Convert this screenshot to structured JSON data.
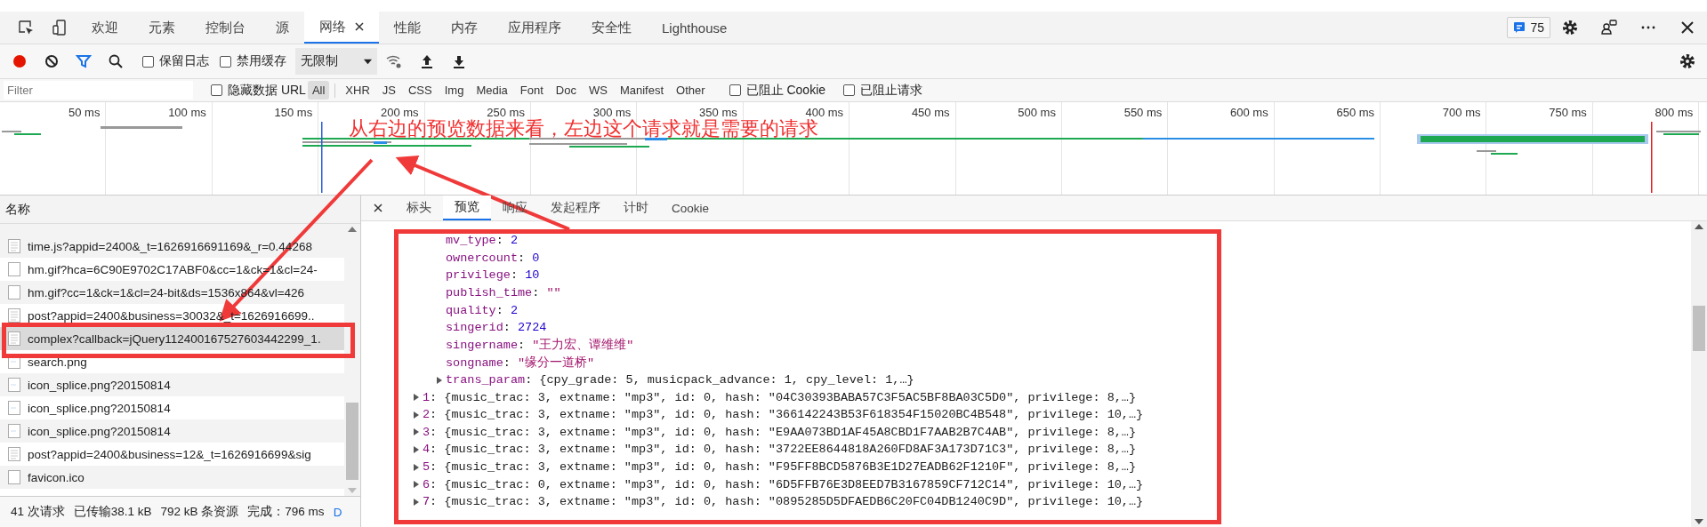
{
  "devtools_tabs": [
    {
      "label": "欢迎",
      "selected": false,
      "closable": false
    },
    {
      "label": "元素",
      "selected": false,
      "closable": false
    },
    {
      "label": "控制台",
      "selected": false,
      "closable": false
    },
    {
      "label": "源",
      "selected": false,
      "closable": false
    },
    {
      "label": "网络",
      "selected": true,
      "closable": true
    },
    {
      "label": "性能",
      "selected": false,
      "closable": false
    },
    {
      "label": "内存",
      "selected": false,
      "closable": false
    },
    {
      "label": "应用程序",
      "selected": false,
      "closable": false
    },
    {
      "label": "安全性",
      "selected": false,
      "closable": false
    },
    {
      "label": "Lighthouse",
      "selected": false,
      "closable": false
    }
  ],
  "issues_badge": "75",
  "toolbar": {
    "recording": true,
    "preserve_log": {
      "label": "保留日志",
      "checked": false
    },
    "disable_cache": {
      "label": "禁用缓存",
      "checked": false
    },
    "throttling": "无限制"
  },
  "filter_bar": {
    "placeholder": "Filter",
    "hide_data_urls": {
      "label": "隐藏数据 URL",
      "checked": false
    },
    "types": [
      {
        "label": "All",
        "selected": true
      },
      {
        "label": "XHR",
        "selected": false
      },
      {
        "label": "JS",
        "selected": false
      },
      {
        "label": "CSS",
        "selected": false
      },
      {
        "label": "Img",
        "selected": false
      },
      {
        "label": "Media",
        "selected": false
      },
      {
        "label": "Font",
        "selected": false
      },
      {
        "label": "Doc",
        "selected": false
      },
      {
        "label": "WS",
        "selected": false
      },
      {
        "label": "Manifest",
        "selected": false
      },
      {
        "label": "Other",
        "selected": false
      }
    ],
    "blocked_cookies": {
      "label": "已阻止 Cookie",
      "checked": false
    },
    "blocked_requests": {
      "label": "已阻止请求",
      "checked": false
    }
  },
  "overview": {
    "ticks": [
      "50 ms",
      "100 ms",
      "150 ms",
      "200 ms",
      "250 ms",
      "300 ms",
      "350 ms",
      "400 ms",
      "450 ms",
      "500 ms",
      "550 ms",
      "600 ms",
      "650 ms",
      "700 ms",
      "750 ms",
      "800 ms"
    ]
  },
  "annotation": {
    "text": "从右边的预览数据来看，左边这个请求就是需要的请求"
  },
  "requests": {
    "column": "名称",
    "rows": [
      {
        "name": "time.js?appid=2400&_t=1626916691169&_r=0.44268",
        "kind": "document",
        "selected": false
      },
      {
        "name": "hm.gif?hca=6C90E9702C17ABF0&cc=1&ck=1&cl=24-",
        "kind": "blank",
        "selected": false
      },
      {
        "name": "hm.gif?cc=1&ck=1&cl=24-bit&ds=1536x864&vl=426",
        "kind": "blank",
        "selected": false
      },
      {
        "name": "post?appid=2400&business=30032&_t=1626916699..",
        "kind": "document",
        "selected": false
      },
      {
        "name": "complex?callback=jQuery112400167527603442299_1.",
        "kind": "document",
        "selected": true
      },
      {
        "name": "search.png",
        "kind": "image",
        "selected": false
      },
      {
        "name": "icon_splice.png?20150814",
        "kind": "image",
        "selected": false
      },
      {
        "name": "icon_splice.png?20150814",
        "kind": "image",
        "selected": false
      },
      {
        "name": "icon_splice.png?20150814",
        "kind": "image",
        "selected": false
      },
      {
        "name": "post?appid=2400&business=12&_t=1626916699&sig",
        "kind": "document",
        "selected": false
      },
      {
        "name": "favicon.ico",
        "kind": "blank",
        "selected": false
      }
    ]
  },
  "status_bar": {
    "items": [
      "41 次请求",
      "已传输38.1 kB",
      "792 kB 条资源",
      "完成：796 ms"
    ],
    "link": "D"
  },
  "detail_tabs": [
    {
      "label": "标头",
      "selected": false
    },
    {
      "label": "预览",
      "selected": true
    },
    {
      "label": "响应",
      "selected": false
    },
    {
      "label": "发起程序",
      "selected": false
    },
    {
      "label": "计时",
      "selected": false
    },
    {
      "label": "Cookie",
      "selected": false
    }
  ],
  "preview": {
    "fields": [
      {
        "key": "mv_type",
        "sep": ":",
        "value": "2",
        "kind": "number"
      },
      {
        "key": "ownercount",
        "sep": ":",
        "value": "0",
        "kind": "number"
      },
      {
        "key": "privilege",
        "sep": ":",
        "value": "10",
        "kind": "number"
      },
      {
        "key": "publish_time",
        "sep": ":",
        "value": "\"\"",
        "kind": "string"
      },
      {
        "key": "quality",
        "sep": ":",
        "value": "2",
        "kind": "number"
      },
      {
        "key": "singerid",
        "sep": ":",
        "value": "2724",
        "kind": "number"
      },
      {
        "key": "singername",
        "sep": ":",
        "value": "\"王力宏、谭维维\"",
        "kind": "string"
      },
      {
        "key": "songname",
        "sep": ":",
        "value": "\"缘分一道桥\"",
        "kind": "string"
      },
      {
        "key": "trans_param",
        "sep": ":",
        "value": "{cpy_grade: 5, musicpack_advance: 1, cpy_level: 1,…}",
        "kind": "object",
        "expanded": false
      }
    ],
    "items": [
      {
        "key": "1",
        "sep": ":",
        "value": "{music_trac: 3, extname: \"mp3\", id: 0, hash: \"04C30393BABA57C3F5AC5BF8BA03C5D0\", privilege: 8,…}",
        "expanded": false
      },
      {
        "key": "2",
        "sep": ":",
        "value": "{music_trac: 3, extname: \"mp3\", id: 0, hash: \"366142243B53F618354F15020BC4B548\", privilege: 10,…}",
        "expanded": false
      },
      {
        "key": "3",
        "sep": ":",
        "value": "{music_trac: 3, extname: \"mp3\", id: 0, hash: \"E9AA073BD1AF45A8CBD1F7AAB2B7C4AB\", privilege: 8,…}",
        "expanded": false
      },
      {
        "key": "4",
        "sep": ":",
        "value": "{music_trac: 3, extname: \"mp3\", id: 0, hash: \"3722EE8644818A260FD8AF3A173D71C3\", privilege: 8,…}",
        "expanded": false
      },
      {
        "key": "5",
        "sep": ":",
        "value": "{music_trac: 3, extname: \"mp3\", id: 0, hash: \"F95FF8BCD5876B3E1D27EADB62F1210F\", privilege: 8,…}",
        "expanded": false
      },
      {
        "key": "6",
        "sep": ":",
        "value": "{music_trac: 0, extname: \"mp3\", id: 0, hash: \"6D5FFB76E3D8EED7B3167859CF712C14\", privilege: 10,…}",
        "expanded": false
      },
      {
        "key": "7",
        "sep": ":",
        "value": "{music_trac: 3, extname: \"mp3\", id: 0, hash: \"0895285D5DFAEDB6C20FC04DB1240C9D\", privilege: 10,…}",
        "expanded": false
      }
    ]
  }
}
